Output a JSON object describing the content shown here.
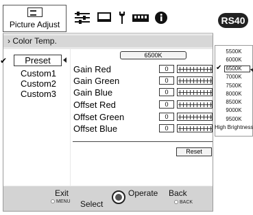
{
  "header": {
    "main_tab_label": "Picture Adjust",
    "icons": [
      "sliders-icon",
      "display-icon",
      "wrench-icon",
      "network-icon",
      "info-icon"
    ],
    "badge": "RS40"
  },
  "section": {
    "title": "› Color Temp."
  },
  "left_menu": {
    "selected": "Preset",
    "items": [
      "Custom1",
      "Custom2",
      "Custom3"
    ]
  },
  "color_temp": {
    "value": "6500K"
  },
  "params": [
    {
      "label": "Gain Red",
      "value": "0"
    },
    {
      "label": "Gain Green",
      "value": "0"
    },
    {
      "label": "Gain Blue",
      "value": "0"
    },
    {
      "label": "Offset Red",
      "value": "0"
    },
    {
      "label": "Offset Green",
      "value": "0"
    },
    {
      "label": "Offset Blue",
      "value": "0"
    }
  ],
  "reset_label": "Reset",
  "dropdown": {
    "options": [
      "5500K",
      "6000K",
      "6500K",
      "7000K",
      "7500K",
      "8000K",
      "8500K",
      "9000K",
      "9500K",
      "High Brightness"
    ],
    "selected": "6500K"
  },
  "footer": {
    "exit_label": "Exit",
    "exit_key": "MENU",
    "select_label": "Select",
    "operate_label": "Operate",
    "back_label": "Back",
    "back_key": "BACK"
  }
}
